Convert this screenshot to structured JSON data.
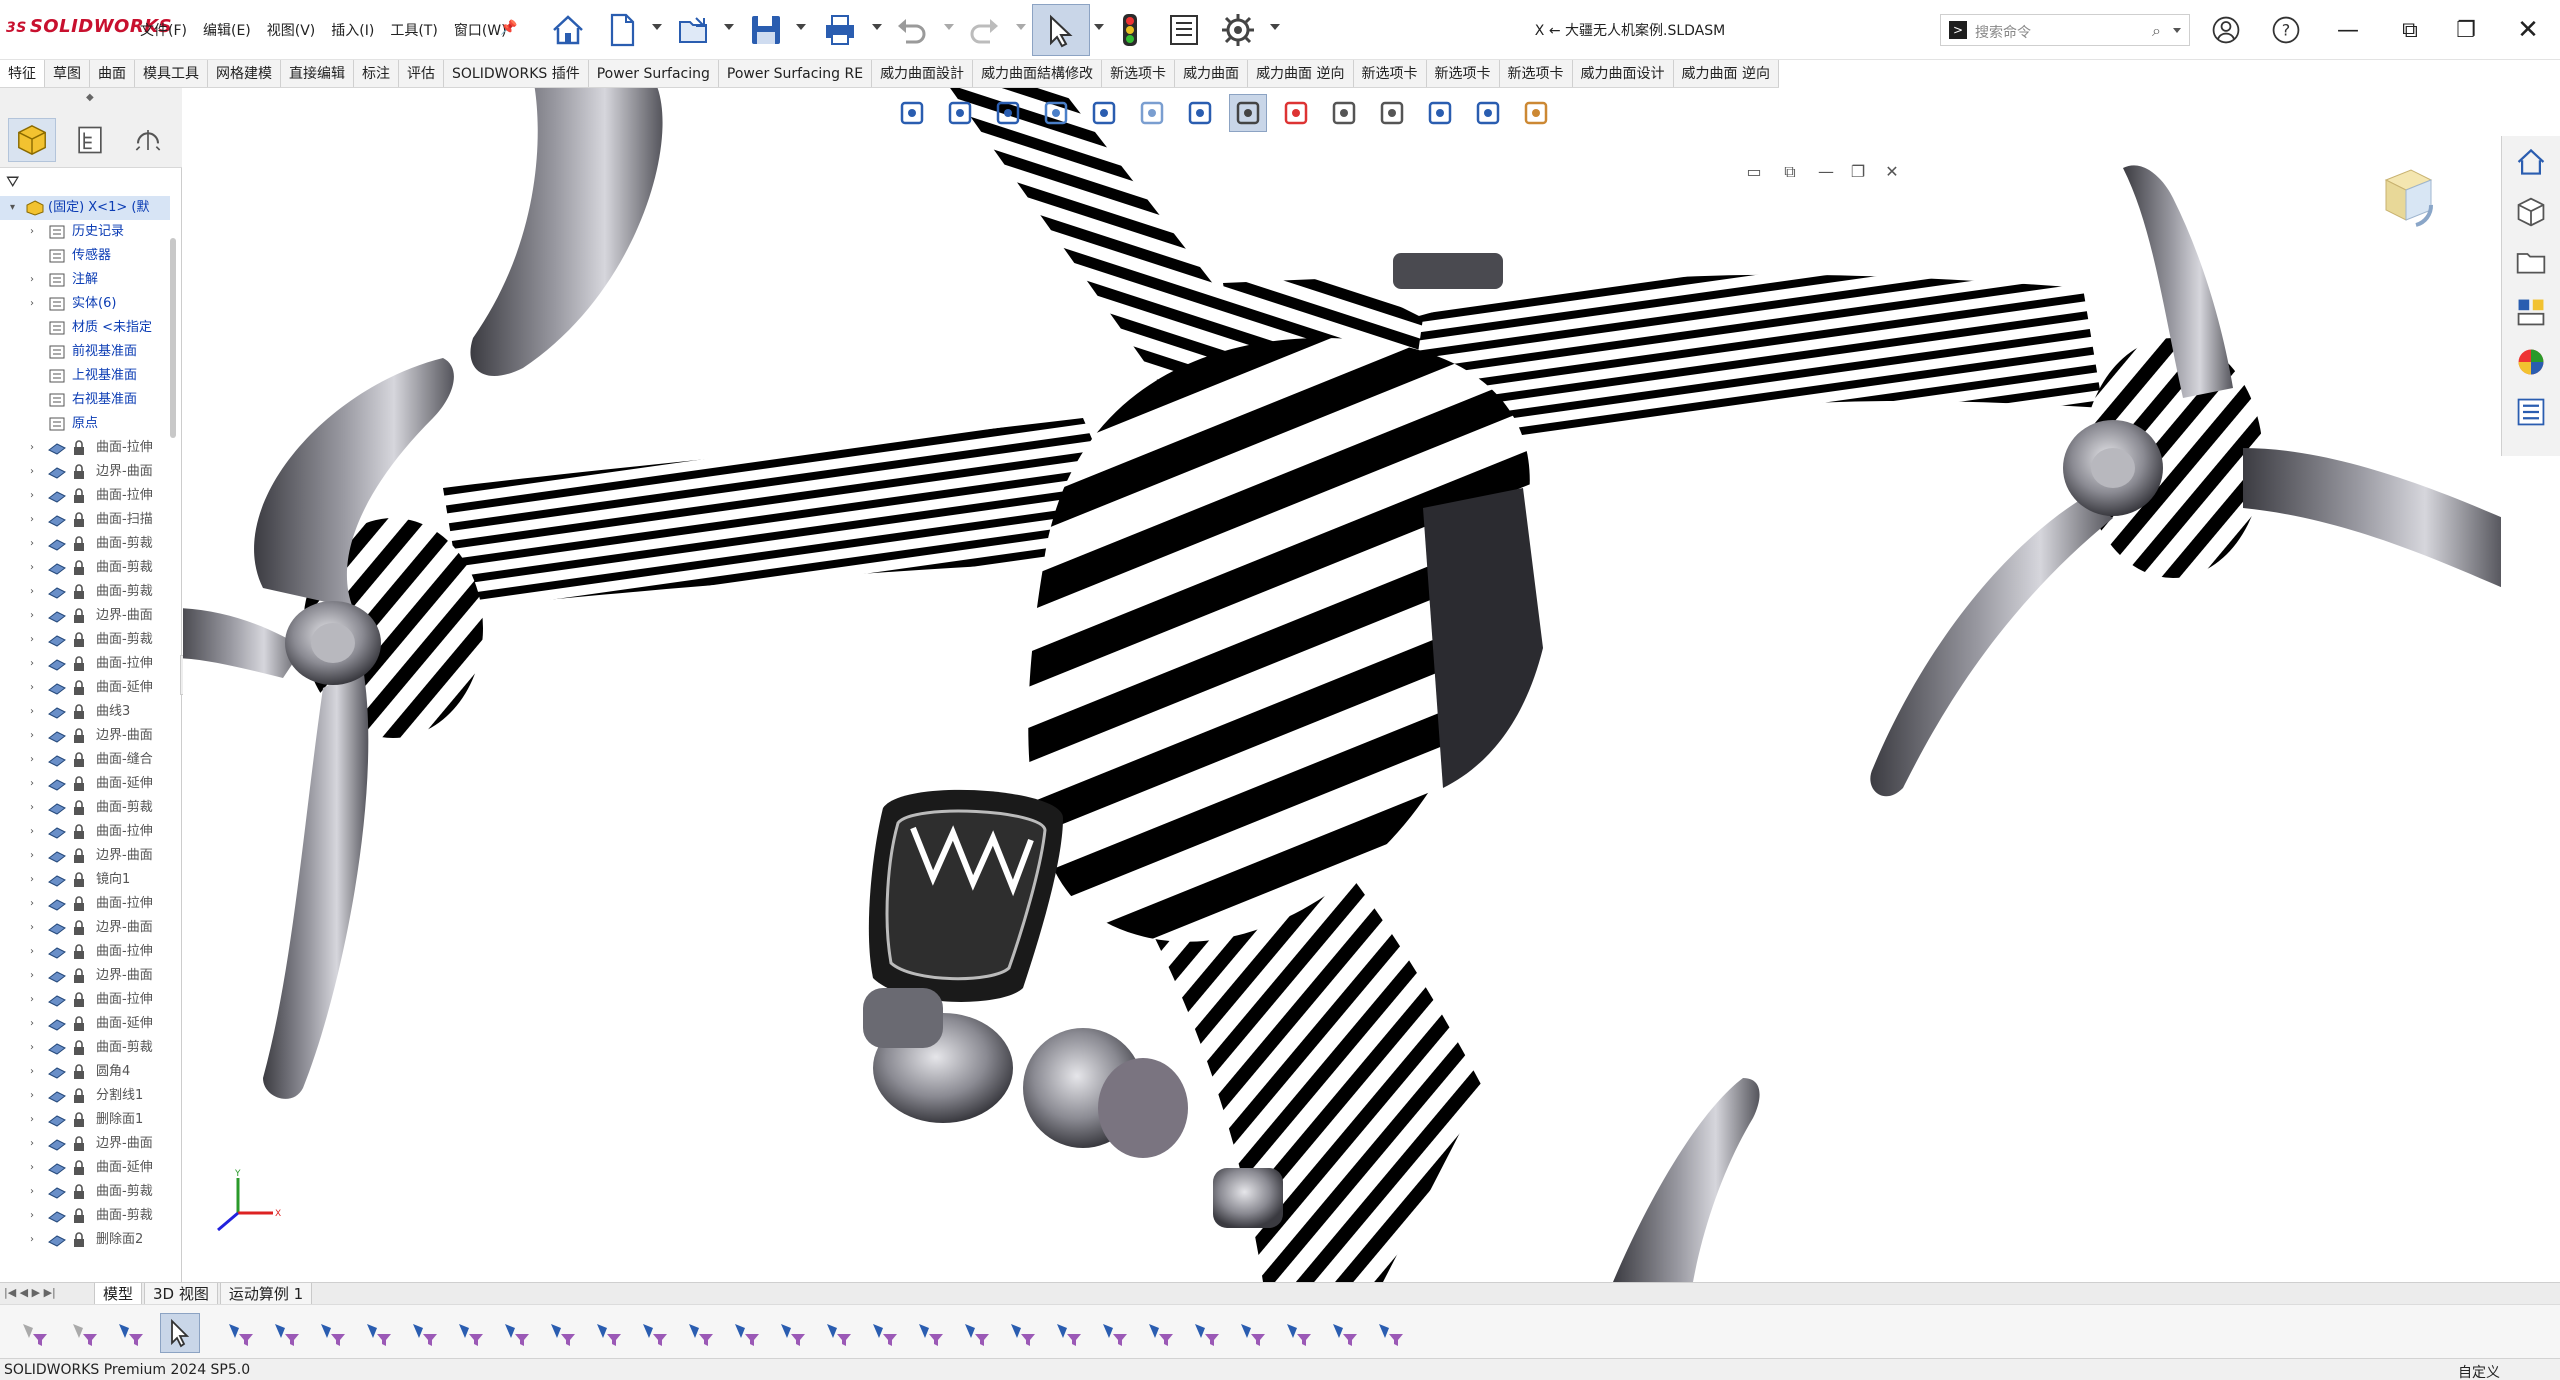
{
  "app": {
    "name": "SOLIDWORKS",
    "brand_color": "#c8102e"
  },
  "menu": [
    "文件(F)",
    "编辑(E)",
    "视图(V)",
    "插入(I)",
    "工具(T)",
    "窗口(W)"
  ],
  "quick_access": [
    "home-icon",
    "new-document-icon",
    "open-icon",
    "save-icon",
    "print-icon",
    "undo-icon",
    "redo-icon",
    "select-icon",
    "rebuild-icon",
    "file-properties-icon",
    "options-icon"
  ],
  "document_title": "X ← 大疆无人机案例.SLDASM",
  "search": {
    "placeholder": "搜索命令"
  },
  "command_tabs": [
    "特征",
    "草图",
    "曲面",
    "模具工具",
    "网格建模",
    "直接编辑",
    "标注",
    "评估",
    "SOLIDWORKS 插件",
    "Power Surfacing",
    "Power Surfacing RE",
    "威力曲面設計",
    "威力曲面結構修改",
    "新选项卡",
    "威力曲面",
    "威力曲面 逆向",
    "新选项卡",
    "新选项卡",
    "新选项卡",
    "威力曲面设计",
    "威力曲面 逆向"
  ],
  "tree": {
    "root": "(固定) X<1> (默",
    "nodes": [
      {
        "label": "历史记录",
        "icon": "history-icon",
        "expand": true
      },
      {
        "label": "传感器",
        "icon": "sensor-icon",
        "expand": false
      },
      {
        "label": "注解",
        "icon": "annotation-icon",
        "expand": true
      },
      {
        "label": "实体(6)",
        "icon": "solid-bodies-icon",
        "expand": true
      },
      {
        "label": "材质 <未指定",
        "icon": "material-icon",
        "expand": false
      },
      {
        "label": "前视基准面",
        "icon": "plane-icon",
        "expand": false
      },
      {
        "label": "上视基准面",
        "icon": "plane-icon",
        "expand": false
      },
      {
        "label": "右视基准面",
        "icon": "plane-icon",
        "expand": false
      },
      {
        "label": "原点",
        "icon": "origin-icon",
        "expand": false
      }
    ],
    "features": [
      "曲面-拉伸",
      "边界-曲面",
      "曲面-拉伸",
      "曲面-扫描",
      "曲面-剪裁",
      "曲面-剪裁",
      "曲面-剪裁",
      "边界-曲面",
      "曲面-剪裁",
      "曲面-拉伸",
      "曲面-延伸",
      "曲线3",
      "边界-曲面",
      "曲面-缝合",
      "曲面-延伸",
      "曲面-剪裁",
      "曲面-拉伸",
      "边界-曲面",
      "镜向1",
      "曲面-拉伸",
      "边界-曲面",
      "曲面-拉伸",
      "边界-曲面",
      "曲面-拉伸",
      "曲面-延伸",
      "曲面-剪裁",
      "圆角4",
      "分割线1",
      "删除面1",
      "边界-曲面",
      "曲面-延伸",
      "曲面-剪裁",
      "曲面-剪裁",
      "删除面2"
    ]
  },
  "bottom_tabs": [
    "模型",
    "3D 视图",
    "运动算例 1"
  ],
  "status": {
    "left": "SOLIDWORKS Premium 2024 SP5.0",
    "right": "自定义"
  },
  "viewport": {
    "display_mode": "zebra-stripes",
    "model": "quadcopter drone"
  }
}
